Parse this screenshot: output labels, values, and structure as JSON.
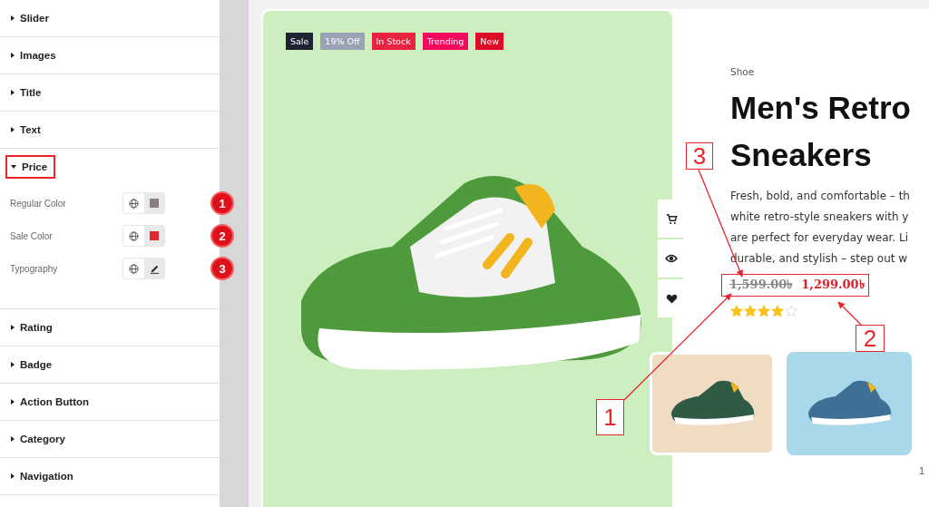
{
  "panel": {
    "sections": [
      {
        "label": "Slider",
        "expanded": false,
        "highlighted": false
      },
      {
        "label": "Images",
        "expanded": false,
        "highlighted": false
      },
      {
        "label": "Title",
        "expanded": false,
        "highlighted": false
      },
      {
        "label": "Text",
        "expanded": false,
        "highlighted": false
      },
      {
        "label": "Price",
        "expanded": true,
        "highlighted": true,
        "controls": [
          {
            "label": "Regular Color",
            "kind": "color",
            "color": "#8a7f80",
            "marker": "1"
          },
          {
            "label": "Sale Color",
            "kind": "color",
            "color": "#e0282e",
            "marker": "2"
          },
          {
            "label": "Typography",
            "kind": "typography",
            "marker": "3"
          }
        ]
      },
      {
        "label": "Rating",
        "expanded": false,
        "highlighted": false
      },
      {
        "label": "Badge",
        "expanded": false,
        "highlighted": false
      },
      {
        "label": "Action Button",
        "expanded": false,
        "highlighted": false
      },
      {
        "label": "Category",
        "expanded": false,
        "highlighted": false
      },
      {
        "label": "Navigation",
        "expanded": false,
        "highlighted": false
      }
    ]
  },
  "product": {
    "badges": [
      {
        "label": "Sale",
        "color": "#1f2433"
      },
      {
        "label": "19% Off",
        "color": "#9aa3b5"
      },
      {
        "label": "In Stock",
        "color": "#e8223f"
      },
      {
        "label": "Trending",
        "color": "#f5075f"
      },
      {
        "label": "New",
        "color": "#dc0a26"
      }
    ],
    "category": "Shoe",
    "title": "Men's Retro Sneakers",
    "description_lines": [
      "Fresh, bold, and comfortable – th",
      "white retro-style sneakers with y",
      "are perfect for everyday wear. Li",
      "durable, and stylish – step out w"
    ],
    "regular_price": "1,599.00৳",
    "sale_price": "1,299.00৳",
    "stars": 4,
    "thumbnails": [
      {
        "selected": true,
        "color": "#efdcc3"
      },
      {
        "selected": false,
        "color": "#a9d8ea"
      }
    ],
    "page_number": "1"
  },
  "callouts": [
    {
      "number": "1"
    },
    {
      "number": "2"
    },
    {
      "number": "3"
    }
  ]
}
